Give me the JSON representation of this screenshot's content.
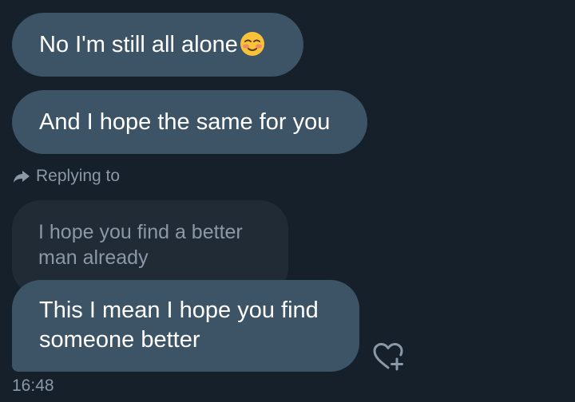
{
  "conversation": {
    "messages": [
      {
        "text": "No I'm still all alone",
        "emoji": "smiling-face-emoji"
      },
      {
        "text": "And I hope the same for you"
      }
    ],
    "reply": {
      "label": "Replying to",
      "icon": "reply-arrow-icon",
      "quoted_text": "I hope you find a better man already",
      "message": "This I mean I hope you find someone better"
    },
    "timestamp": "16:48",
    "react_icon": "heart-plus-icon"
  },
  "colors": {
    "background": "#15202b",
    "bubble": "#3d5466",
    "quoted_bubble": "#202b36",
    "secondary_text": "#8b98a5",
    "emoji_face": "#f8c23a",
    "emoji_blush": "#f07f6b"
  }
}
